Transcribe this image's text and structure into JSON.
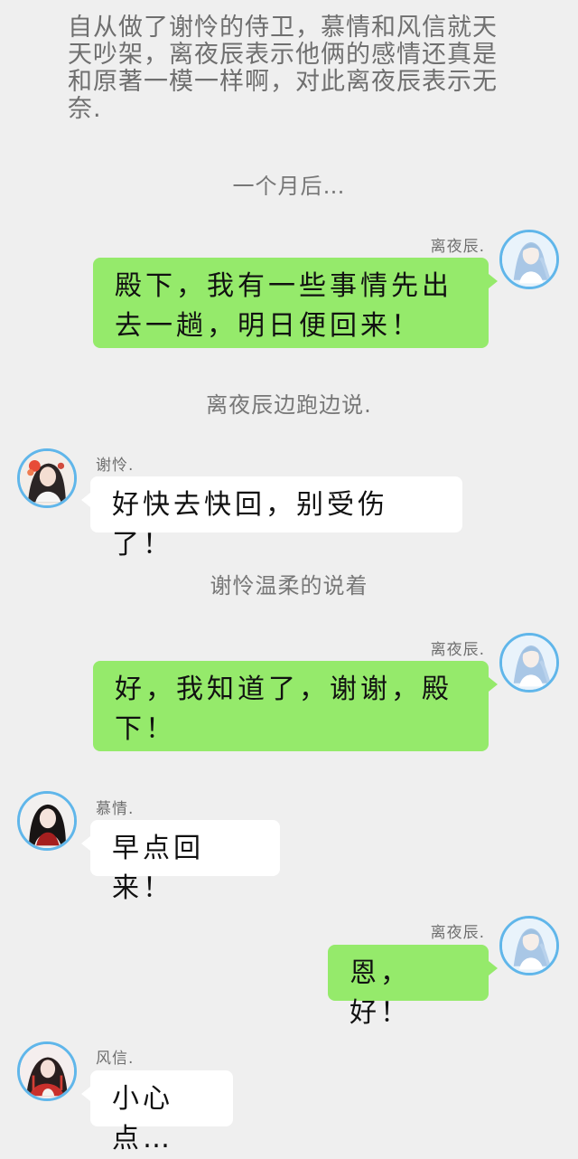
{
  "story": {
    "intro": "自从做了谢怜的侍卫，慕情和风信就天天吵架，离夜辰表示他俩的感情还真是和原著一模一样啊，对此离夜辰表示无奈.",
    "time_note": "一个月后…",
    "running_note": "离夜辰边跑边说.",
    "gentle_note": "谢怜温柔的说着"
  },
  "chat": {
    "messages": [
      {
        "speaker": "离夜辰.",
        "text": "殿下，我有一些事情先出去一趟，明日便回来！"
      },
      {
        "speaker": "谢怜.",
        "text": "好快去快回，别受伤了！"
      },
      {
        "speaker": "离夜辰.",
        "text": "好，我知道了，谢谢，殿下！"
      },
      {
        "speaker": "慕情.",
        "text": "早点回来！"
      },
      {
        "speaker": "离夜辰.",
        "text": "恩，好！"
      },
      {
        "speaker": "风信.",
        "text": "小心点…"
      }
    ]
  },
  "avatars": {
    "li_ye_chen": "long-hair-avatar-icon",
    "xie_lian": "flower-avatar-icon",
    "mu_qing": "dark-hair-avatar-icon",
    "feng_xin": "red-robe-avatar-icon"
  },
  "colors": {
    "background": "#efefef",
    "green_bubble": "#95ea6b",
    "white_bubble": "#ffffff",
    "avatar_border": "#60b6ea",
    "note_text": "#777777"
  }
}
